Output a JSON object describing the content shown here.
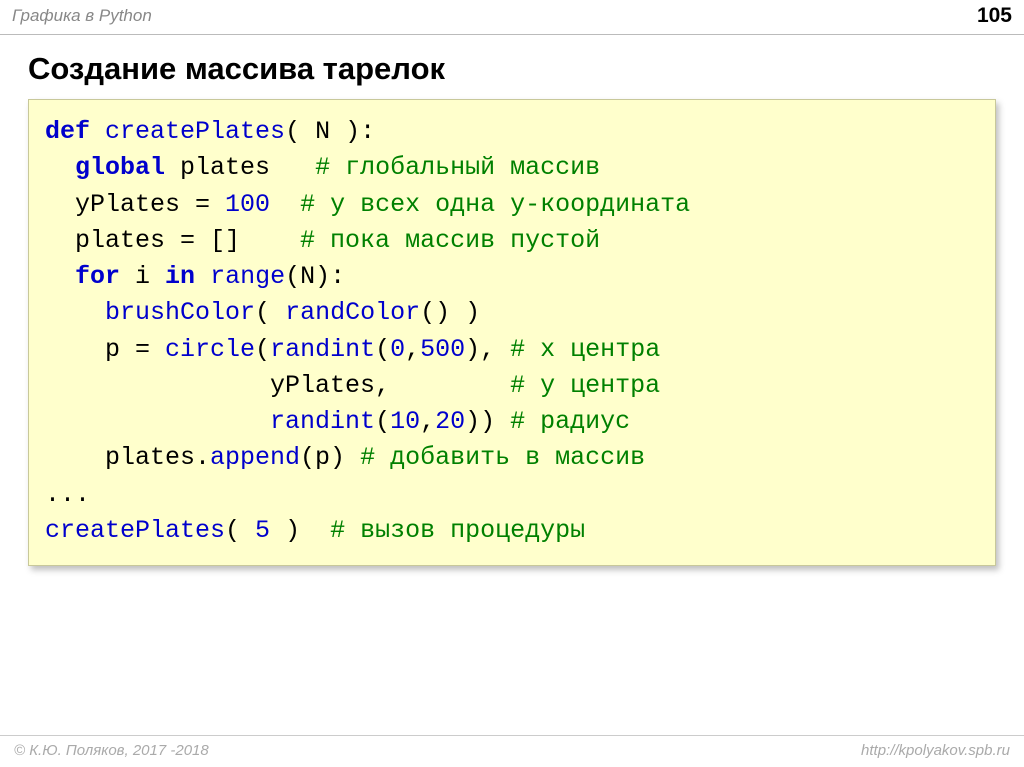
{
  "header": {
    "title": "Графика в Python",
    "page": "105"
  },
  "title": "Создание массива тарелок",
  "code": {
    "l1_def": "def",
    "l1_fn": "createPlates",
    "l1_rest": "( N ):",
    "l2_kw": "global",
    "l2_var": " plates   ",
    "l2_cm": "# глобальный массив",
    "l3_a": "  yPlates = ",
    "l3_num": "100",
    "l3_sp": "  ",
    "l3_cm": "# у всех одна y-координата",
    "l4_a": "  plates = []    ",
    "l4_cm": "# пока массив пустой",
    "l5_for": "for",
    "l5_mid": " i ",
    "l5_in": "in",
    "l5_sp": " ",
    "l5_rng": "range",
    "l5_tail": "(N):",
    "l6_ind": "    ",
    "l6_fn1": "brushColor",
    "l6_p1": "( ",
    "l6_fn2": "randColor",
    "l6_p2": "() )",
    "l7_ind": "    p = ",
    "l7_fn": "circle",
    "l7_p1": "(",
    "l7_fn2": "randint",
    "l7_p2": "(",
    "l7_n1": "0",
    "l7_c1": ",",
    "l7_n2": "500",
    "l7_p3": "), ",
    "l7_cm": "# x центра",
    "l8_ind": "               yPlates,        ",
    "l8_cm": "# y центра",
    "l9_ind": "               ",
    "l9_fn": "randint",
    "l9_p1": "(",
    "l9_n1": "10",
    "l9_c": ",",
    "l9_n2": "20",
    "l9_p2": ")) ",
    "l9_cm": "# радиус",
    "l10_ind": "    plates.",
    "l10_fn": "append",
    "l10_rest": "(p) ",
    "l10_cm": "# добавить в массив",
    "l11": "...",
    "l12_fn": "createPlates",
    "l12_p1": "( ",
    "l12_n": "5",
    "l12_p2": " )  ",
    "l12_cm": "# вызов процедуры"
  },
  "footer": {
    "left": "© К.Ю. Поляков, 2017 -2018",
    "right": "http://kpolyakov.spb.ru"
  }
}
